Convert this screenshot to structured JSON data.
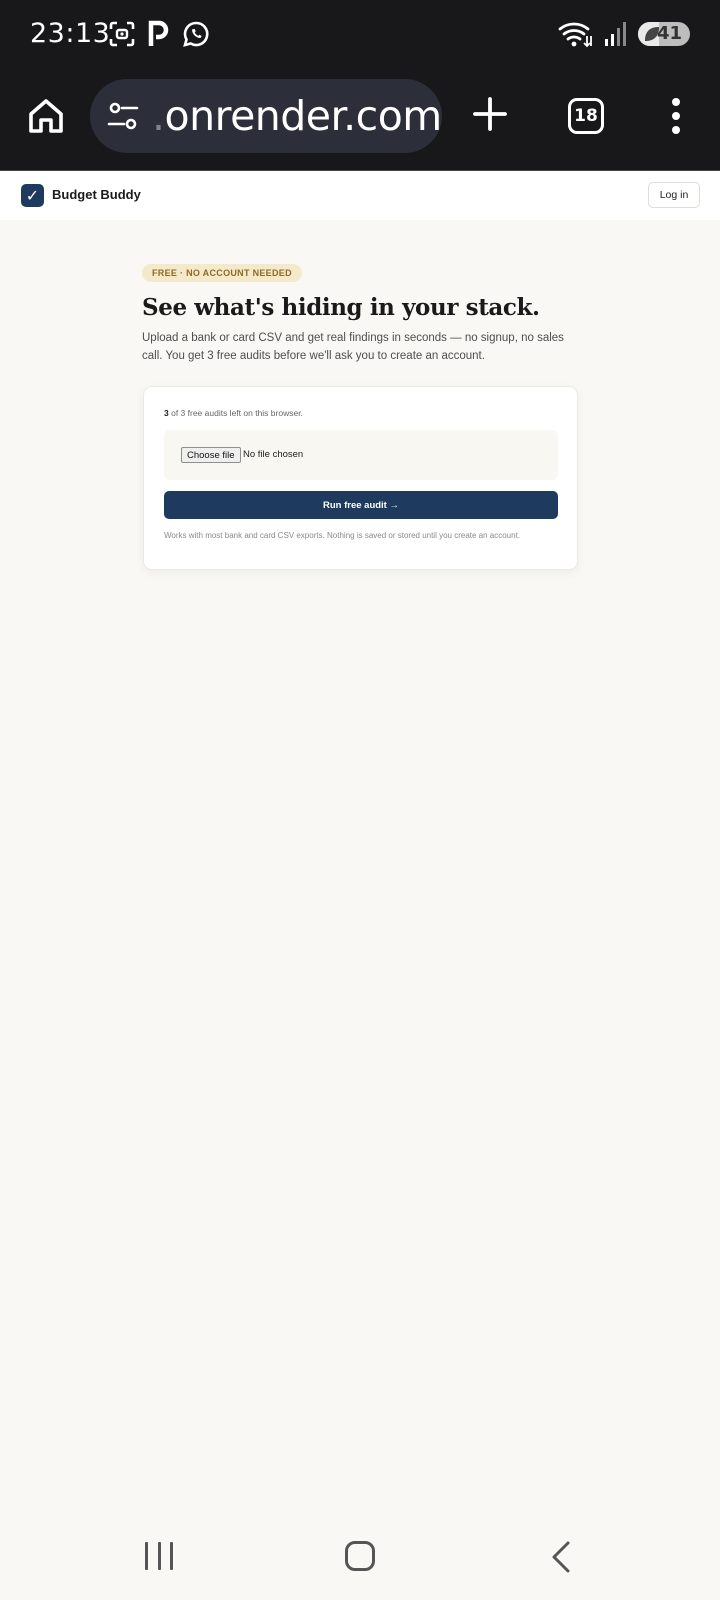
{
  "status_bar": {
    "time": "23:13",
    "battery_level": "41",
    "battery_fraction": 0.41,
    "icons_left": [
      "screenshot-icon",
      "parking-app-icon",
      "whatsapp-icon"
    ],
    "icons_right": [
      "wifi-icon",
      "signal-icon",
      "battery-icon"
    ]
  },
  "browser": {
    "url_prefix": ".",
    "url_domain": "onrender.com",
    "tab_count": "18",
    "icons": [
      "home-icon",
      "site-settings-icon",
      "plus-icon",
      "tabs-icon",
      "kebab-menu-icon"
    ]
  },
  "site_header": {
    "logo_glyph": "✓",
    "brand": "Budget Buddy",
    "login_label": "Log in"
  },
  "hero": {
    "badge": "FREE · NO ACCOUNT NEEDED",
    "headline": "See what's hiding in your stack.",
    "subtext": "Upload a bank or card CSV and get real findings in seconds — no signup, no sales call. You get 3 free audits before we'll ask you to create an account."
  },
  "card": {
    "audits_remaining": "3",
    "audits_rest": " of 3 free audits left on this browser.",
    "choose_file_label": "Choose file",
    "no_file_text": "No file chosen",
    "run_label": "Run free audit →",
    "note": "Works with most bank and card CSV exports. Nothing is saved or stored until you create an account."
  },
  "colors": {
    "brand_navy": "#1e3a5f",
    "badge_bg": "#f5e9cc",
    "badge_text": "#8f6a22",
    "page_bg": "#f9f8f5",
    "chrome_bg": "#18181b"
  }
}
